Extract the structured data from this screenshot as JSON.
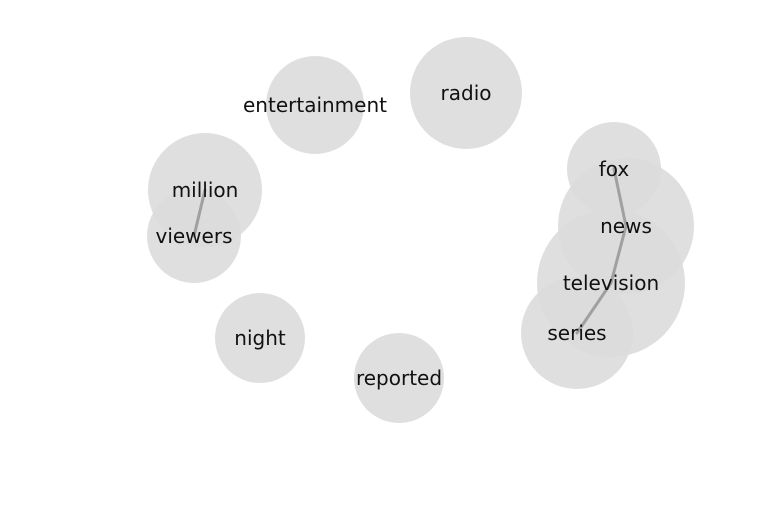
{
  "colors": {
    "bubble": "#dcdcdc",
    "link": "#a0a0a0",
    "text": "#111111",
    "background": "#ffffff"
  },
  "nodes": [
    {
      "id": "entertainment",
      "label": "entertainment"
    },
    {
      "id": "radio",
      "label": "radio"
    },
    {
      "id": "million",
      "label": "million"
    },
    {
      "id": "viewers",
      "label": "viewers"
    },
    {
      "id": "night",
      "label": "night"
    },
    {
      "id": "reported",
      "label": "reported"
    },
    {
      "id": "fox",
      "label": "fox"
    },
    {
      "id": "news",
      "label": "news"
    },
    {
      "id": "television",
      "label": "television"
    },
    {
      "id": "series",
      "label": "series"
    }
  ],
  "links": [
    {
      "source": "million",
      "target": "viewers"
    },
    {
      "source": "fox",
      "target": "news"
    },
    {
      "source": "news",
      "target": "television"
    },
    {
      "source": "television",
      "target": "series"
    }
  ]
}
